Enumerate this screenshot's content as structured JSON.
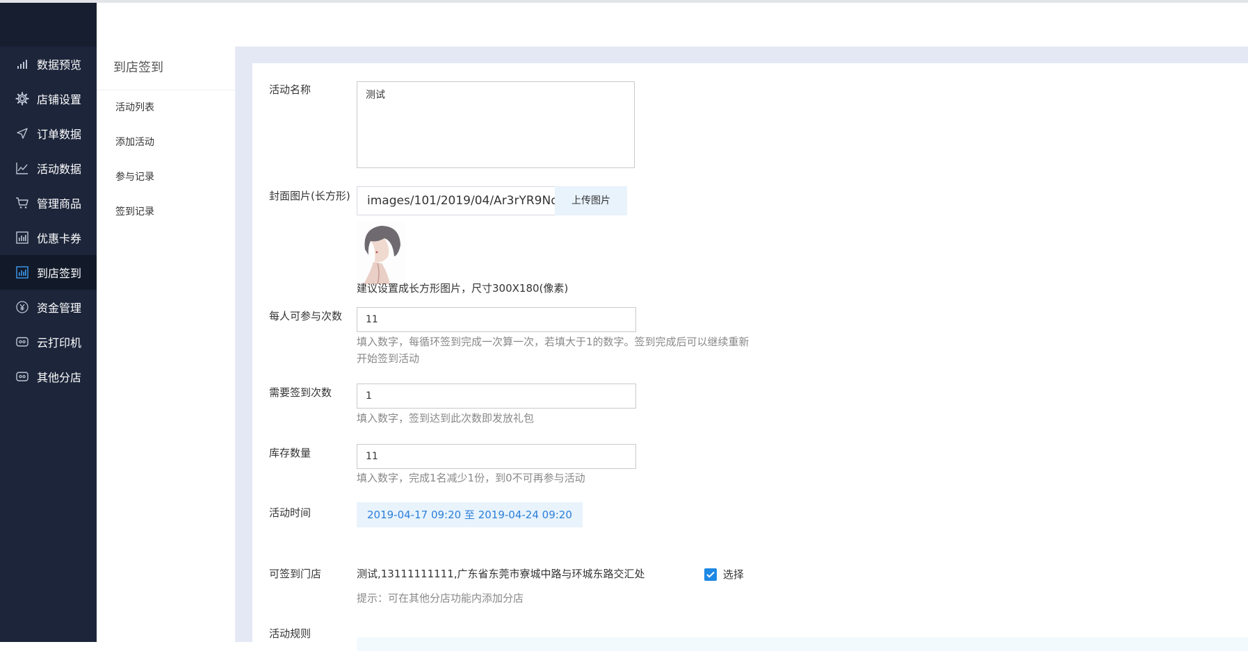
{
  "nav": {
    "items": [
      {
        "label": "数据预览",
        "icon": "bar-chart-icon"
      },
      {
        "label": "店铺设置",
        "icon": "gear-icon"
      },
      {
        "label": "订单数据",
        "icon": "send-icon"
      },
      {
        "label": "活动数据",
        "icon": "line-chart-icon"
      },
      {
        "label": "管理商品",
        "icon": "cart-icon"
      },
      {
        "label": "优惠卡券",
        "icon": "stats-icon"
      },
      {
        "label": "到店签到",
        "icon": "stats-icon",
        "active": true
      },
      {
        "label": "资金管理",
        "icon": "yen-icon"
      },
      {
        "label": "云打印机",
        "icon": "printer-icon"
      },
      {
        "label": "其他分店",
        "icon": "printer-icon"
      }
    ]
  },
  "submenu": {
    "title": "到店签到",
    "items": [
      {
        "label": "活动列表"
      },
      {
        "label": "添加活动"
      },
      {
        "label": "参与记录"
      },
      {
        "label": "签到记录"
      }
    ]
  },
  "form": {
    "name": {
      "label": "活动名称",
      "value": "测试"
    },
    "cover": {
      "label": "封面图片(长方形)",
      "path": "images/101/2019/04/Ar3rYR9Nq'",
      "upload_label": "上传图片",
      "hint": "建议设置成长方形图片，尺寸300X180(像素)"
    },
    "per_person": {
      "label": "每人可参与次数",
      "value": "11",
      "help_line1": "填入数字，每循环签到完成一次算一次，若填大于1的数字。签到完成后可以继续重新",
      "help_line2": "开始签到活动"
    },
    "required": {
      "label": "需要签到次数",
      "value": "1",
      "help": "填入数字，签到达到此次数即发放礼包"
    },
    "stock": {
      "label": "库存数量",
      "value": "11",
      "help": "填入数字，完成1名减少1份，到0不可再参与活动"
    },
    "time": {
      "label": "活动时间",
      "value": "2019-04-17 09:20 至 2019-04-24 09:20"
    },
    "store": {
      "label": "可签到门店",
      "value": "测试,13111111111,广东省东莞市寮城中路与环城东路交汇处",
      "checkbox_label": "选择",
      "checked": true,
      "hint": "提示：可在其他分店功能内添加分店"
    },
    "rules": {
      "label": "活动规则"
    }
  },
  "colors": {
    "sidebar": "#1c253a",
    "accent": "#1e88e5",
    "content_bg": "#e4e8f5"
  }
}
